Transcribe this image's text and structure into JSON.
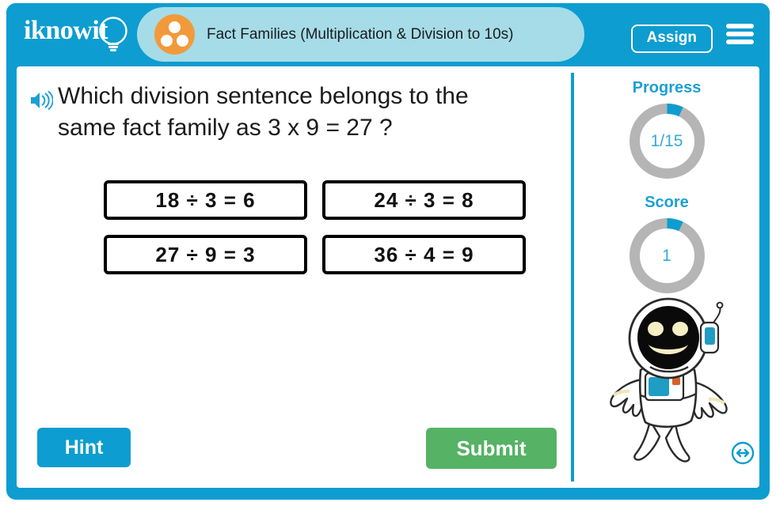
{
  "header": {
    "logo_text": "iknowit",
    "logo_icon": "lightbulb-icon",
    "title_icon": "three-dots-circle-icon",
    "title": "Fact Families (Multiplication & Division to 10s)",
    "assign_label": "Assign",
    "menu_icon": "hamburger-menu-icon"
  },
  "question": {
    "audio_icon": "speaker-icon",
    "line1": "Which division sentence belongs to the",
    "line2": "same fact family as 3 x 9 = 27 ?",
    "full_text": "Which division sentence belongs to the same fact family as 3 x 9 = 27 ?"
  },
  "answers": [
    {
      "label": "18 ÷ 3 = 6"
    },
    {
      "label": "24 ÷ 3 = 8"
    },
    {
      "label": "27 ÷ 9 = 3"
    },
    {
      "label": "36 ÷ 4 = 9"
    }
  ],
  "actions": {
    "hint_label": "Hint",
    "submit_label": "Submit"
  },
  "sidebar": {
    "progress": {
      "label": "Progress",
      "value": "1/15",
      "current": 1,
      "total": 15,
      "percent": 7
    },
    "score": {
      "label": "Score",
      "value": "1",
      "percent": 7
    },
    "mascot_icon": "astronaut-mascot",
    "resize_icon": "left-right-arrows-icon"
  },
  "colors": {
    "brand_blue": "#0d9dd0",
    "title_pill": "#a5dce8",
    "accent_orange": "#f29a3b",
    "submit_green": "#56b265",
    "ring_track": "#b5b5b5",
    "ring_fill": "#0d9dd0",
    "text_dark": "#1b1b1b"
  }
}
